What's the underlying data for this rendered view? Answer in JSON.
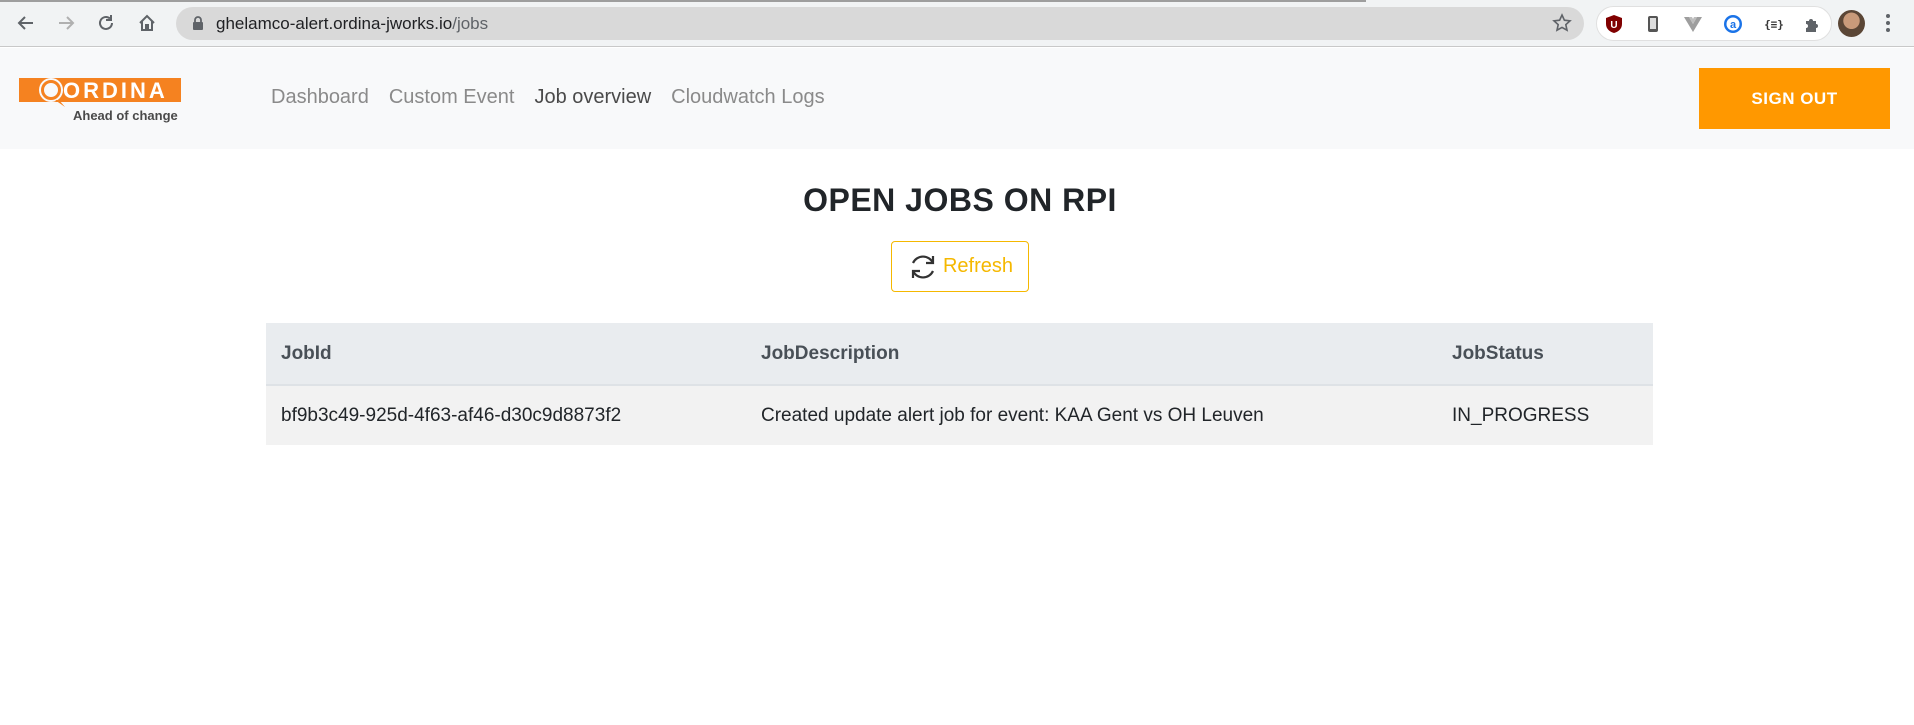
{
  "browser": {
    "url_host": "ghelamco-alert.ordina-jworks.io",
    "url_path": "/jobs",
    "icons": [
      "back-icon",
      "forward-icon",
      "reload-icon",
      "home-icon",
      "lock-icon",
      "bookmark-star-icon",
      "ublock-icon",
      "phone-extension-icon",
      "vue-devtools-icon",
      "a-extension-icon",
      "json-extension-icon",
      "puzzle-extension-icon",
      "profile-avatar",
      "menu-dots-icon"
    ],
    "ext_json_label": "{≡}"
  },
  "header": {
    "logo_text": "ORDINA",
    "logo_tagline": "Ahead of change",
    "nav": [
      {
        "label": "Dashboard",
        "active": false
      },
      {
        "label": "Custom Event",
        "active": false
      },
      {
        "label": "Job overview",
        "active": true
      },
      {
        "label": "Cloudwatch Logs",
        "active": false
      }
    ],
    "sign_out_label": "SIGN OUT"
  },
  "main": {
    "title": "OPEN JOBS ON RPI",
    "refresh_label": "Refresh",
    "table": {
      "columns": [
        "JobId",
        "JobDescription",
        "JobStatus"
      ],
      "rows": [
        [
          "bf9b3c49-925d-4f63-af46-d30c9d8873f2",
          "Created update alert job for event: KAA Gent vs OH Leuven",
          "IN_PROGRESS"
        ]
      ]
    }
  },
  "colors": {
    "brand_orange": "#ff9800",
    "refresh_yellow": "#f5b800",
    "logo_orange": "#f58220"
  }
}
